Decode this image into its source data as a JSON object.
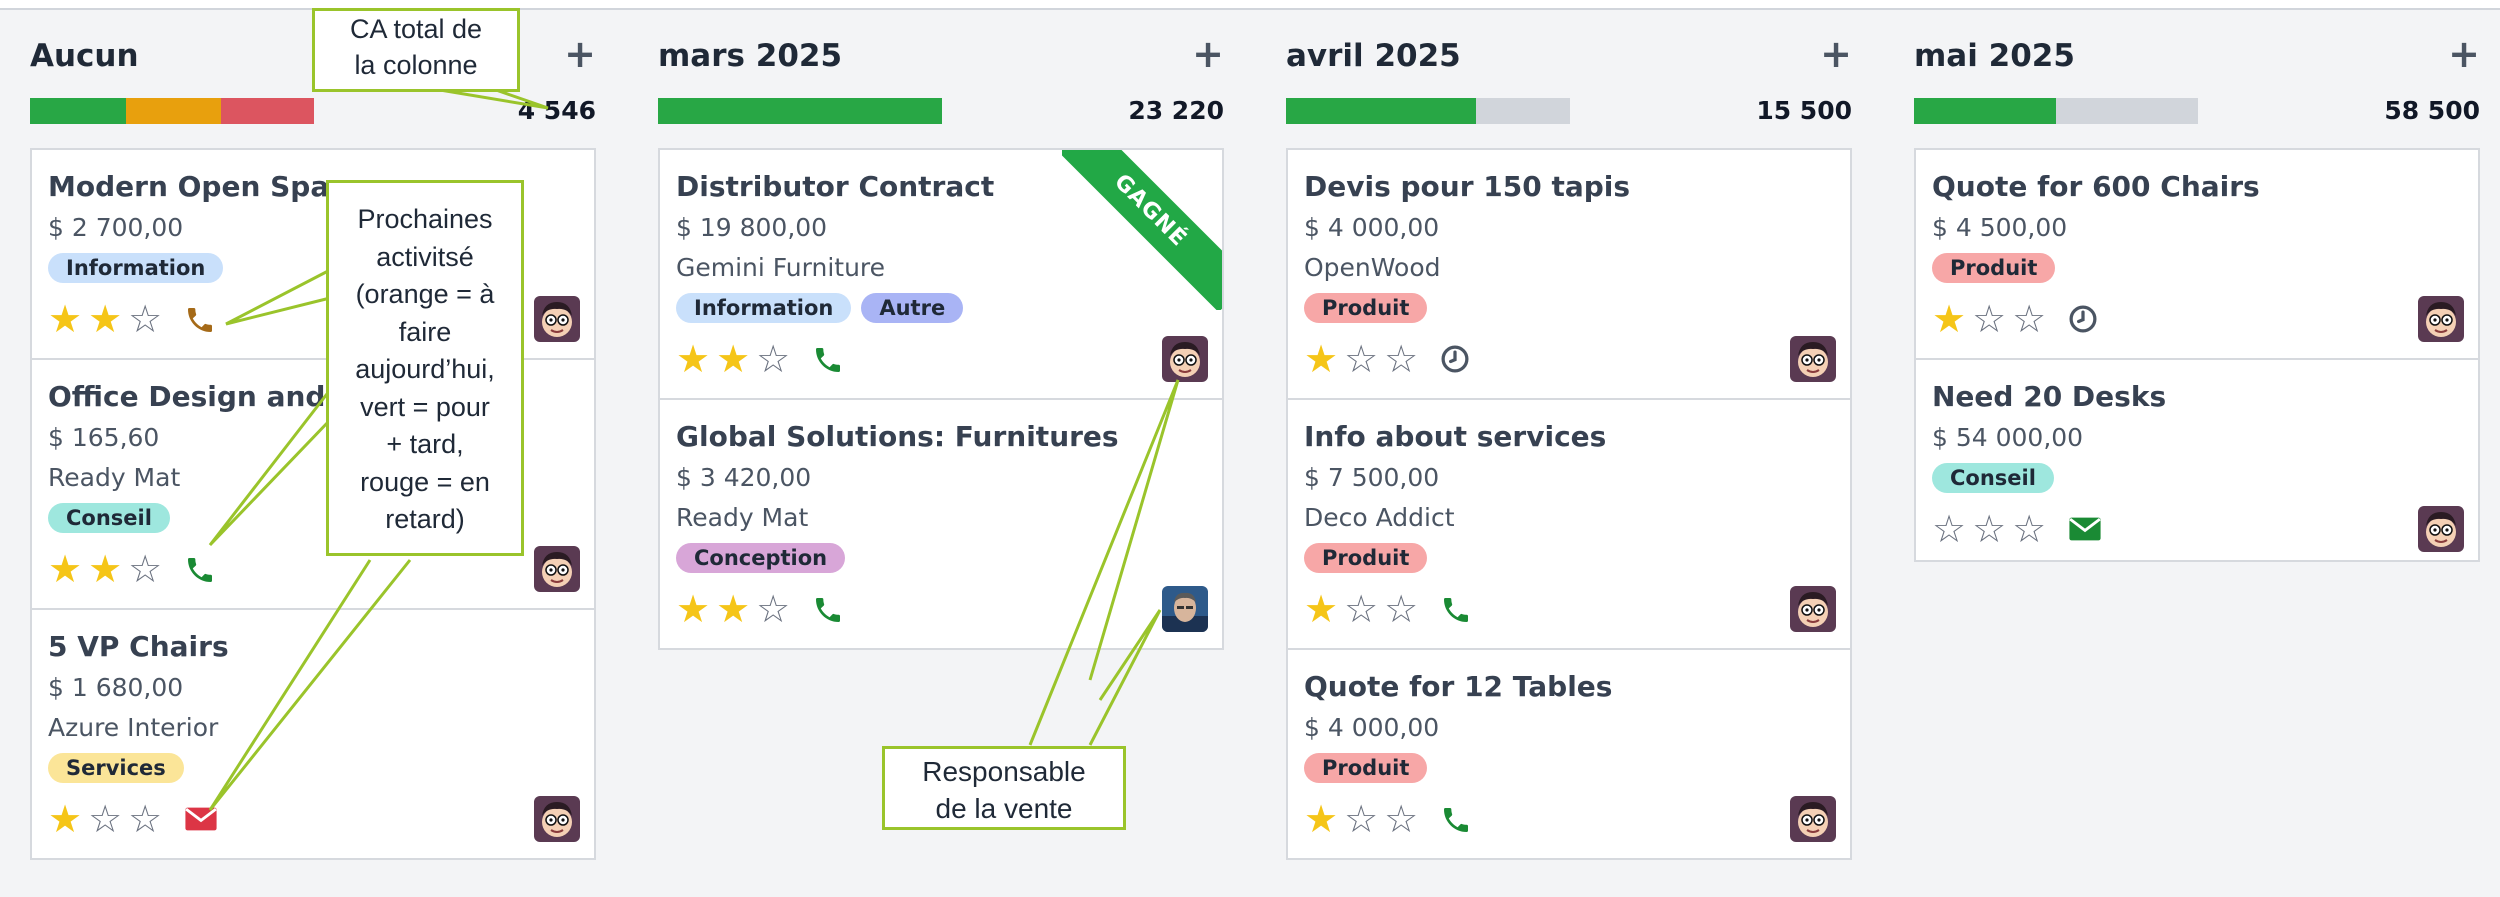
{
  "columns": [
    {
      "title": "Aucun",
      "add_label": "+",
      "total": "4 546",
      "progress": [
        {
          "color": "#28a745",
          "fraction": 0.339
        },
        {
          "color": "#e8a00d",
          "fraction": 0.333
        },
        {
          "color": "#dc5560",
          "fraction": 0.328
        }
      ],
      "cards": [
        {
          "title": "Modern Open Space",
          "amount": "$ 2 700,00",
          "company": "",
          "tags": [
            {
              "label": "Information",
              "color": "#c9e0fb"
            }
          ],
          "stars": 2,
          "activity": "phone-icon",
          "activity_color": "#a56a18",
          "avatar": "cartoon"
        },
        {
          "title": "Office Design and Ar",
          "amount": "$ 165,60",
          "company": "Ready Mat",
          "tags": [
            {
              "label": "Conseil",
              "color": "#9ee7de"
            }
          ],
          "stars": 2,
          "activity": "phone-icon",
          "activity_color": "#1a8a34",
          "avatar": "cartoon"
        },
        {
          "title": "5 VP Chairs",
          "amount": "$ 1 680,00",
          "company": "Azure Interior",
          "tags": [
            {
              "label": "Services",
              "color": "#fbe598"
            }
          ],
          "stars": 1,
          "activity": "envelope-icon",
          "activity_color": "#dc3545",
          "avatar": "cartoon"
        }
      ]
    },
    {
      "title": "mars 2025",
      "add_label": "+",
      "total": "23 220",
      "progress": [
        {
          "color": "#28a745",
          "fraction": 1.0
        }
      ],
      "cards": [
        {
          "title": "Distributor Contract",
          "amount": "$ 19 800,00",
          "company": "Gemini Furniture",
          "tags": [
            {
              "label": "Information",
              "color": "#c9e0fb"
            },
            {
              "label": "Autre",
              "color": "#a9b4f5"
            }
          ],
          "stars": 2,
          "activity": "phone-icon",
          "activity_color": "#1a8a34",
          "avatar": "cartoon",
          "ribbon": "GAGNÉ"
        },
        {
          "title": "Global Solutions: Furnitures",
          "amount": "$ 3 420,00",
          "company": "Ready Mat",
          "tags": [
            {
              "label": "Conception",
              "color": "#d8a6d8"
            }
          ],
          "stars": 2,
          "activity": "phone-icon",
          "activity_color": "#1a8a34",
          "avatar": "photo"
        }
      ]
    },
    {
      "title": "avril 2025",
      "add_label": "+",
      "total": "15 500",
      "progress": [
        {
          "color": "#28a745",
          "fraction": 0.67
        }
      ],
      "cards": [
        {
          "title": "Devis pour 150 tapis",
          "amount": "$ 4 000,00",
          "company": "OpenWood",
          "tags": [
            {
              "label": "Produit",
              "color": "#f7a7a7"
            }
          ],
          "stars": 1,
          "activity": "clock-icon",
          "activity_color": "#4b5563",
          "avatar": "cartoon"
        },
        {
          "title": "Info about services",
          "amount": "$ 7 500,00",
          "company": "Deco Addict",
          "tags": [
            {
              "label": "Produit",
              "color": "#f7a7a7"
            }
          ],
          "stars": 1,
          "activity": "phone-icon",
          "activity_color": "#1a8a34",
          "avatar": "cartoon"
        },
        {
          "title": "Quote for 12 Tables",
          "amount": "$ 4 000,00",
          "company": "",
          "tags": [
            {
              "label": "Produit",
              "color": "#f7a7a7"
            }
          ],
          "stars": 1,
          "activity": "phone-icon",
          "activity_color": "#1a8a34",
          "avatar": "cartoon"
        }
      ]
    },
    {
      "title": "mai 2025",
      "add_label": "+",
      "total": "58 500",
      "progress": [
        {
          "color": "#28a745",
          "fraction": 0.5
        }
      ],
      "cards": [
        {
          "title": "Quote for 600 Chairs",
          "amount": "$ 4 500,00",
          "company": "",
          "tags": [
            {
              "label": "Produit",
              "color": "#f7a7a7"
            }
          ],
          "stars": 1,
          "activity": "clock-icon",
          "activity_color": "#4b5563",
          "avatar": "cartoon"
        },
        {
          "title": "Need 20 Desks",
          "amount": "$ 54 000,00",
          "company": "",
          "tags": [
            {
              "label": "Conseil",
              "color": "#9ee7de"
            }
          ],
          "stars": 0,
          "activity": "envelope-icon",
          "activity_color": "#1a8a34",
          "avatar": "cartoon"
        }
      ]
    }
  ],
  "callouts": {
    "total": {
      "line1": "CA total de",
      "line2": "la colonne"
    },
    "activities": [
      "Prochaines",
      "activitsé",
      "(orange = à",
      "faire",
      "aujourd’hui,",
      "vert = pour",
      "+ tard,",
      "rouge = en",
      "retard)"
    ],
    "salesperson": {
      "line1": "Responsable",
      "line2": "de la vente"
    }
  }
}
